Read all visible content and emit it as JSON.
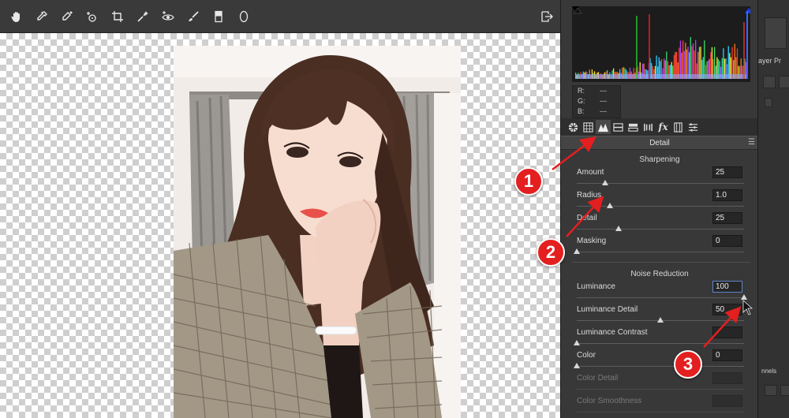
{
  "colors": {
    "accent_red": "#e41f1f",
    "panel_bg": "#383838",
    "value_focus": "#5b86c7"
  },
  "toolbar": {
    "tools": [
      "hand-icon",
      "eyedropper-icon",
      "color-sampler-icon",
      "target-adjust-icon",
      "crop-icon",
      "retouch-icon",
      "red-eye-icon",
      "brush-icon",
      "graduated-filter-icon",
      "radial-filter-icon"
    ],
    "export_icon": "export-icon"
  },
  "histogram": {
    "rgb_labels": [
      "R:",
      "G:",
      "B:"
    ],
    "rgb_values": [
      "---",
      "---",
      "---"
    ]
  },
  "panel_tabs": [
    "basic-icon",
    "tone-curve-icon",
    "detail-icon",
    "hsl-icon",
    "split-toning-icon",
    "lens-icon",
    "fx-icon",
    "calibration-icon",
    "presets-icon"
  ],
  "panel": {
    "title": "Detail",
    "sharpening": {
      "title": "Sharpening",
      "rows": [
        {
          "label": "Amount",
          "value": "25",
          "level": 0.17
        },
        {
          "label": "Radius",
          "value": "1.0",
          "level": 0.2
        },
        {
          "label": "Detail",
          "value": "25",
          "level": 0.25
        },
        {
          "label": "Masking",
          "value": "0",
          "level": 0.0
        }
      ]
    },
    "noise": {
      "title": "Noise Reduction",
      "rows": [
        {
          "label": "Luminance",
          "value": "100",
          "level": 1.0
        },
        {
          "label": "Luminance Detail",
          "value": "50",
          "level": 0.5
        },
        {
          "label": "Luminance Contrast",
          "value": "",
          "level": 0.0
        },
        {
          "label": "Color",
          "value": "0",
          "level": 0.0
        },
        {
          "label": "Color Detail",
          "value": "",
          "level": null
        },
        {
          "label": "Color Smoothness",
          "value": "",
          "level": null
        }
      ]
    }
  },
  "far_panel": {
    "label": "ayer Pr",
    "label2": "nnels"
  },
  "callouts": [
    "1",
    "2",
    "3"
  ]
}
